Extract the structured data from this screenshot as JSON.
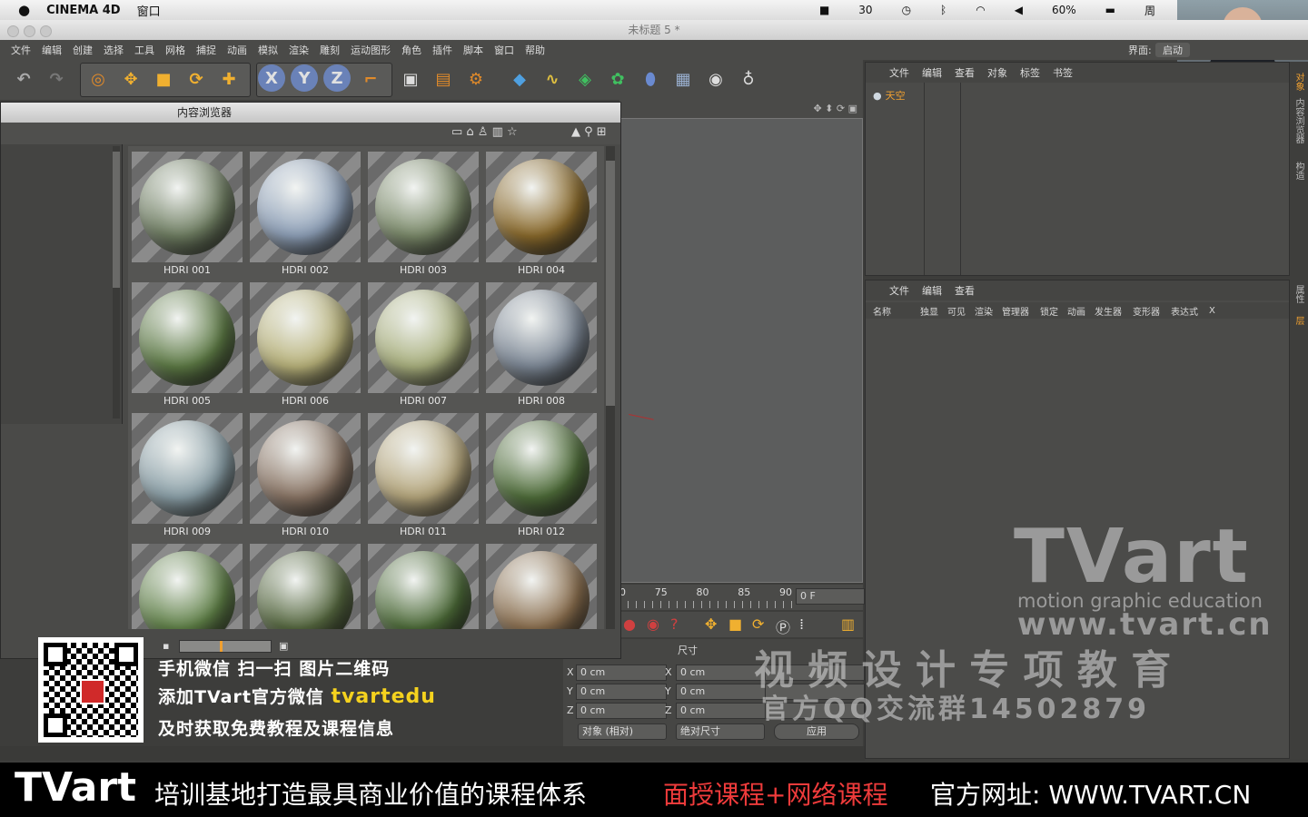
{
  "mac_menubar": {
    "app": "CINEMA 4D",
    "window_menu": "窗口",
    "pdf_count": "30",
    "battery": "60%",
    "day": "周"
  },
  "window_title": "未标题 5 *",
  "menus": [
    "文件",
    "编辑",
    "创建",
    "选择",
    "工具",
    "网格",
    "捕捉",
    "动画",
    "模拟",
    "渲染",
    "雕刻",
    "运动图形",
    "角色",
    "插件",
    "脚本",
    "窗口",
    "帮助"
  ],
  "layout_label": "界面:",
  "layout_value": "启动",
  "object_manager": {
    "menus": [
      "文件",
      "编辑",
      "查看",
      "对象",
      "标签",
      "书签"
    ],
    "object_name": "天空"
  },
  "attribute_manager": {
    "menus": [
      "文件",
      "编辑",
      "查看"
    ],
    "columns": [
      "名称",
      "独显",
      "可见",
      "渲染",
      "管理器",
      "锁定",
      "动画",
      "发生器",
      "变形器",
      "表达式",
      "X"
    ]
  },
  "content_browser": {
    "title": "内容浏览器",
    "items": [
      {
        "label": "HDRI 001",
        "color": "#6f7e62"
      },
      {
        "label": "HDRI 002",
        "color": "#8ea0b8"
      },
      {
        "label": "HDRI 003",
        "color": "#7b8a6a"
      },
      {
        "label": "HDRI 004",
        "color": "#8a6a2c"
      },
      {
        "label": "HDRI 005",
        "color": "#5d7a45"
      },
      {
        "label": "HDRI 006",
        "color": "#b8b27a"
      },
      {
        "label": "HDRI 007",
        "color": "#a9b07e"
      },
      {
        "label": "HDRI 008",
        "color": "#7d8896"
      },
      {
        "label": "HDRI 009",
        "color": "#8ba0a8"
      },
      {
        "label": "HDRI 010",
        "color": "#8a7565"
      },
      {
        "label": "HDRI 011",
        "color": "#b5a67c"
      },
      {
        "label": "HDRI 012",
        "color": "#4f6d3a"
      },
      {
        "label": "",
        "color": "#5f8047"
      },
      {
        "label": "",
        "color": "#55673f"
      },
      {
        "label": "",
        "color": "#4c6a38"
      },
      {
        "label": "",
        "color": "#8a6e4e"
      }
    ]
  },
  "timeline": {
    "ticks": [
      "0",
      "75",
      "80",
      "85",
      "90"
    ],
    "frame": "0 F"
  },
  "coordinates": {
    "size_label": "尺寸",
    "pos_x": "0 cm",
    "pos_y": "0 cm",
    "pos_z": "0 cm",
    "size_x": "0 cm",
    "size_y": "0 cm",
    "size_z": "0 cm",
    "mode_object": "对象 (相对)",
    "mode_size": "绝对尺寸",
    "apply": "应用"
  },
  "watermark": {
    "brand": "TVart",
    "tagline": "motion graphic education",
    "url": "www.tvart.cn",
    "slogan": "视 频 设 计 专 项 教 育",
    "qq": "官方QQ交流群14502879"
  },
  "promo": {
    "line1": "手机微信  扫一扫  图片二维码",
    "line2a": "添加TVart官方微信 ",
    "line2b": "tvartedu",
    "line3": "及时获取免费教程及课程信息"
  },
  "bottom_banner": {
    "brand": "TVart",
    "text": "培训基地打造最具商业价值的课程体系",
    "highlight": "面授课程+网络课程",
    "site": "官方网址: WWW.TVART.CN"
  },
  "side_tabs": [
    "对象",
    "内容浏览器",
    "构造",
    "属性",
    "层"
  ]
}
